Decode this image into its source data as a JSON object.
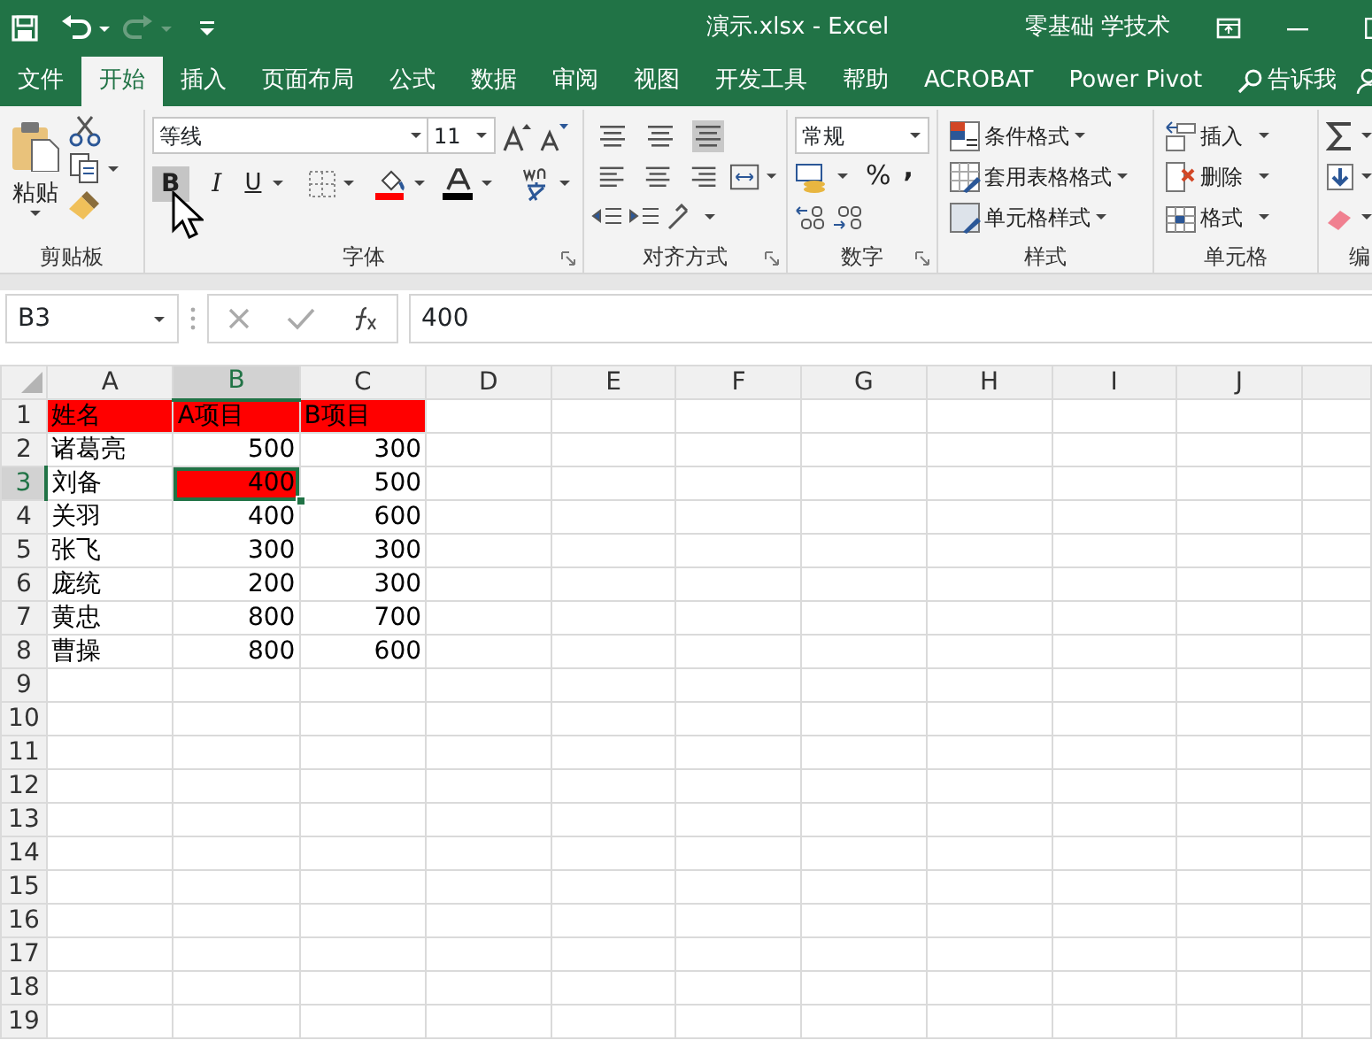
{
  "title_bar": {
    "title": "演示.xlsx  -  Excel",
    "user": "零基础 学技术",
    "redo_disabled": true
  },
  "tabs": [
    {
      "label": "文件",
      "selected": false
    },
    {
      "label": "开始",
      "selected": true
    },
    {
      "label": "插入",
      "selected": false
    },
    {
      "label": "页面布局",
      "selected": false
    },
    {
      "label": "公式",
      "selected": false
    },
    {
      "label": "数据",
      "selected": false
    },
    {
      "label": "审阅",
      "selected": false
    },
    {
      "label": "视图",
      "selected": false
    },
    {
      "label": "开发工具",
      "selected": false
    },
    {
      "label": "帮助",
      "selected": false
    },
    {
      "label": "ACROBAT",
      "selected": false
    },
    {
      "label": "Power Pivot",
      "selected": false
    }
  ],
  "tell_me": "告诉我",
  "ribbon": {
    "clipboard": {
      "label": "剪贴板",
      "paste": "粘贴"
    },
    "font": {
      "label": "字体",
      "font_name": "等线",
      "font_size": "11",
      "bold": "B",
      "italic": "I",
      "underline": "U",
      "bold_hovered": true
    },
    "alignment": {
      "label": "对齐方式"
    },
    "number": {
      "label": "数字",
      "format": "常规",
      "percent": "%",
      "comma": ","
    },
    "styles": {
      "label": "样式",
      "commands": [
        "条件格式",
        "套用表格格式",
        "单元格样式"
      ]
    },
    "cells": {
      "label": "单元格",
      "commands": [
        "插入",
        "删除",
        "格式"
      ]
    },
    "editing": {
      "label": "编"
    }
  },
  "name_box": "B3",
  "formula": "400",
  "columns": [
    "A",
    "B",
    "C",
    "D",
    "E",
    "F",
    "G",
    "H",
    "I",
    "J"
  ],
  "rows": [
    {
      "number": "1",
      "cells": [
        {
          "text": "姓名",
          "kind": "text",
          "filled": true,
          "selected": false
        },
        {
          "text": "A项目",
          "kind": "text",
          "filled": true,
          "selected": false
        },
        {
          "text": "B项目",
          "kind": "text",
          "filled": true,
          "selected": false
        }
      ]
    },
    {
      "number": "2",
      "cells": [
        {
          "text": "诸葛亮",
          "kind": "text",
          "filled": false,
          "selected": false
        },
        {
          "text": "500",
          "kind": "number",
          "filled": false,
          "selected": false
        },
        {
          "text": "300",
          "kind": "number",
          "filled": false,
          "selected": false
        }
      ]
    },
    {
      "number": "3",
      "cells": [
        {
          "text": "刘备",
          "kind": "text",
          "filled": false,
          "selected": false
        },
        {
          "text": "400",
          "kind": "number",
          "filled": true,
          "selected": true
        },
        {
          "text": "500",
          "kind": "number",
          "filled": false,
          "selected": false
        }
      ]
    },
    {
      "number": "4",
      "cells": [
        {
          "text": "关羽",
          "kind": "text",
          "filled": false,
          "selected": false
        },
        {
          "text": "400",
          "kind": "number",
          "filled": false,
          "selected": false
        },
        {
          "text": "600",
          "kind": "number",
          "filled": false,
          "selected": false
        }
      ]
    },
    {
      "number": "5",
      "cells": [
        {
          "text": "张飞",
          "kind": "text",
          "filled": false,
          "selected": false
        },
        {
          "text": "300",
          "kind": "number",
          "filled": false,
          "selected": false
        },
        {
          "text": "300",
          "kind": "number",
          "filled": false,
          "selected": false
        }
      ]
    },
    {
      "number": "6",
      "cells": [
        {
          "text": "庞统",
          "kind": "text",
          "filled": false,
          "selected": false
        },
        {
          "text": "200",
          "kind": "number",
          "filled": false,
          "selected": false
        },
        {
          "text": "300",
          "kind": "number",
          "filled": false,
          "selected": false
        }
      ]
    },
    {
      "number": "7",
      "cells": [
        {
          "text": "黄忠",
          "kind": "text",
          "filled": false,
          "selected": false
        },
        {
          "text": "800",
          "kind": "number",
          "filled": false,
          "selected": false
        },
        {
          "text": "700",
          "kind": "number",
          "filled": false,
          "selected": false
        }
      ]
    },
    {
      "number": "8",
      "cells": [
        {
          "text": "曹操",
          "kind": "text",
          "filled": false,
          "selected": false
        },
        {
          "text": "800",
          "kind": "number",
          "filled": false,
          "selected": false
        },
        {
          "text": "600",
          "kind": "number",
          "filled": false,
          "selected": false
        }
      ]
    },
    {
      "number": "9"
    },
    {
      "number": "10"
    },
    {
      "number": "11"
    },
    {
      "number": "12"
    },
    {
      "number": "13"
    },
    {
      "number": "14"
    },
    {
      "number": "15"
    },
    {
      "number": "16"
    },
    {
      "number": "17"
    },
    {
      "number": "18"
    },
    {
      "number": "19"
    }
  ]
}
